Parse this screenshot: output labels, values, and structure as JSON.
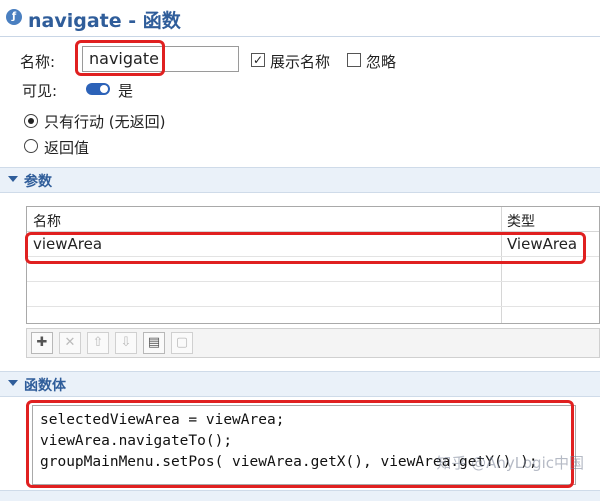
{
  "title": {
    "text": "navigate - 函数"
  },
  "name_field": {
    "label": "名称:",
    "value": "navigate"
  },
  "show_name": {
    "label": "展示名称",
    "checked": true,
    "mark": "✓"
  },
  "ignore": {
    "label": "忽略",
    "checked": false
  },
  "visible": {
    "label": "可见:",
    "value": "是",
    "on": true
  },
  "return_options": {
    "action_only": {
      "label": "只有行动 (无返回)",
      "selected": true
    },
    "return_value": {
      "label": "返回值",
      "selected": false
    }
  },
  "params_section": {
    "title": "参数"
  },
  "params_table": {
    "headers": [
      "名称",
      "类型"
    ],
    "rows": [
      {
        "name": "viewArea",
        "type": "ViewArea"
      }
    ]
  },
  "params_toolbar": {
    "buttons": [
      {
        "icon": "add-icon",
        "glyph": "✚"
      },
      {
        "icon": "delete-icon",
        "glyph": "✕"
      },
      {
        "icon": "move-up-icon",
        "glyph": "⇧"
      },
      {
        "icon": "move-down-icon",
        "glyph": "⇩"
      },
      {
        "icon": "paste-icon",
        "glyph": "▤"
      },
      {
        "icon": "copy-icon",
        "glyph": "▢"
      }
    ]
  },
  "body_section": {
    "title": "函数体"
  },
  "code": {
    "lines": [
      "selectedViewArea = viewArea;",
      "viewArea.navigateTo();",
      "groupMainMenu.setPos( viewArea.getX(), viewArea.getY() );"
    ]
  },
  "watermark": {
    "text": "知乎 @AnyLogic中国"
  },
  "colors": {
    "accent": "#2f5d9a",
    "highlight": "#e02020",
    "section_bg": "#eaf1f9"
  }
}
